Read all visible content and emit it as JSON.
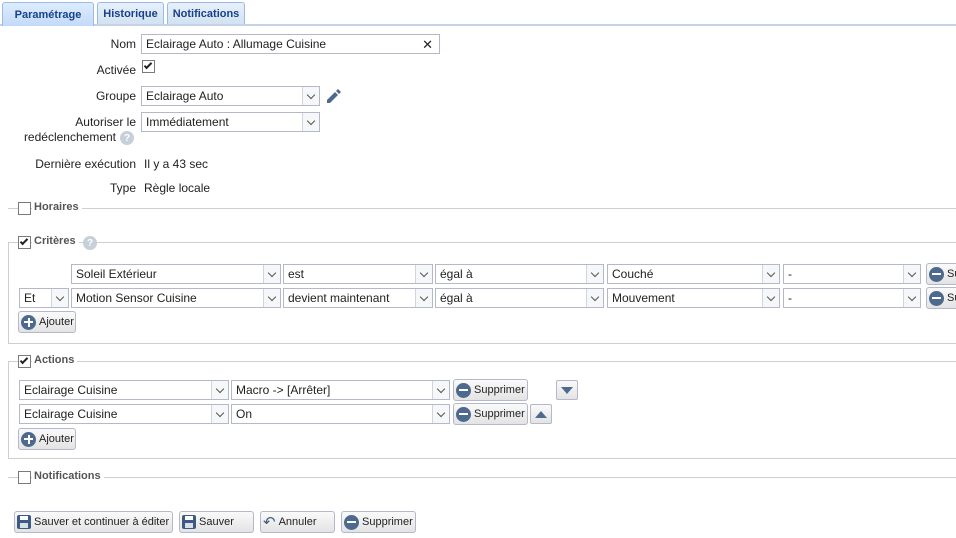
{
  "tabs": [
    {
      "label": "Paramétrage",
      "active": true
    },
    {
      "label": "Historique",
      "active": false
    },
    {
      "label": "Notifications",
      "active": false
    }
  ],
  "form": {
    "nom_label": "Nom",
    "nom_value": "Eclairage Auto : Allumage Cuisine",
    "clear_glyph": "✕",
    "activee_label": "Activée",
    "activee_checked": true,
    "groupe_label": "Groupe",
    "groupe_value": "Eclairage Auto",
    "autoriser_label_1": "Autoriser le",
    "autoriser_label_2": "redéclenchement",
    "autoriser_value": "Immédiatement",
    "derniere_label": "Dernière exécution",
    "derniere_value": "Il y a 43 sec",
    "type_label": "Type",
    "type_value": "Règle locale"
  },
  "sections": {
    "horaires": {
      "label": "Horaires",
      "checked": false
    },
    "criteres": {
      "label": "Critères",
      "checked": true
    },
    "actions": {
      "label": "Actions",
      "checked": true
    },
    "notifications": {
      "label": "Notifications",
      "checked": false
    }
  },
  "criteres_rows": [
    {
      "conj": "",
      "device": "Soleil Extérieur",
      "op": "est",
      "cmp": "égal à",
      "value": "Couché",
      "extra": "-",
      "delete": "Su"
    },
    {
      "conj": "Et",
      "device": "Motion Sensor Cuisine",
      "op": "devient maintenant",
      "cmp": "égal à",
      "value": "Mouvement",
      "extra": "-",
      "delete": "Su"
    }
  ],
  "actions_rows": [
    {
      "device": "Eclairage Cuisine",
      "action": "Macro -> [Arrêter]",
      "delete": "Supprimer"
    },
    {
      "device": "Eclairage Cuisine",
      "action": "On",
      "delete": "Supprimer"
    }
  ],
  "buttons": {
    "ajouter": "Ajouter",
    "save_continue": "Sauver et continuer à éditer",
    "save": "Sauver",
    "cancel": "Annuler",
    "delete": "Supprimer"
  },
  "help_glyph": "?",
  "colors": {
    "tab_text": "#15428b",
    "icon_blue": "#4d6a8e",
    "border": "#b5b8c8"
  }
}
